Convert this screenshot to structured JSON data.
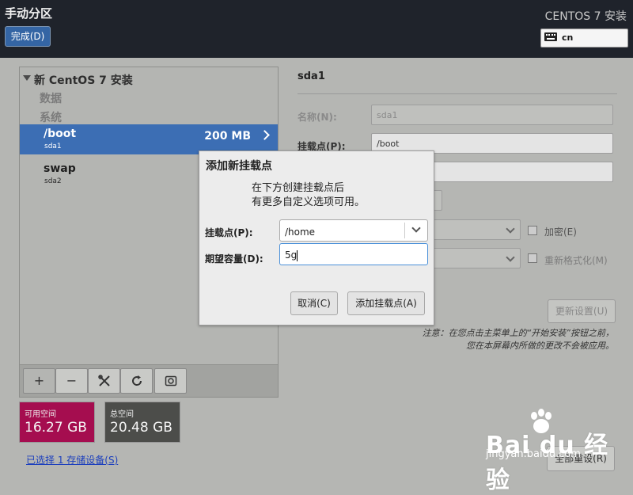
{
  "header": {
    "title": "手动分区",
    "done_label": "完成(D)",
    "product": "CENTOS 7 安装",
    "keyboard_layout": "cn"
  },
  "tree": {
    "title": "新 CentOS 7 安装",
    "group_data": "数据",
    "group_system": "系统",
    "partitions": [
      {
        "mount": "/boot",
        "device": "sda1",
        "size": "200 MB",
        "selected": true
      },
      {
        "mount": "swap",
        "device": "sda2",
        "size": "",
        "selected": false
      }
    ]
  },
  "toolbar": {
    "add": "+",
    "remove": "−",
    "configure_icon": "tools-icon",
    "refresh_icon": "refresh-icon",
    "disk_icon": "disk-icon"
  },
  "space": {
    "available_label": "可用空间",
    "available_value": "16.27 GB",
    "total_label": "总空间",
    "total_value": "20.48 GB",
    "available_color": "#a50d4f",
    "total_color": "#4c4d4a"
  },
  "storage_link": "已选择 1 存储设备(S)",
  "detail": {
    "title": "sda1",
    "name_label": "名称(N):",
    "name_value": "sda1",
    "mount_label": "挂载点(P):",
    "mount_value": "/boot",
    "encrypt_label": "加密(E)",
    "reformat_label": "重新格式化(M)",
    "update_label": "更新设置(U)",
    "note_line1": "注意：在您点击主菜单上的“开始安装”按钮之前，",
    "note_line2": "您在本屏幕内所做的更改不会被应用。",
    "reset_label": "全部重设(R)"
  },
  "dialog": {
    "title": "添加新挂载点",
    "desc_line1": "在下方创建挂载点后",
    "desc_line2": "有更多自定义选项可用。",
    "mount_label": "挂载点(P):",
    "mount_value": "/home",
    "capacity_label": "期望容量(D):",
    "capacity_value": "5g",
    "cancel_label": "取消(C)",
    "add_label": "添加挂载点(A)"
  },
  "watermark": {
    "brand": "Bai du 经验",
    "url": "jingyan.baidu.com"
  }
}
